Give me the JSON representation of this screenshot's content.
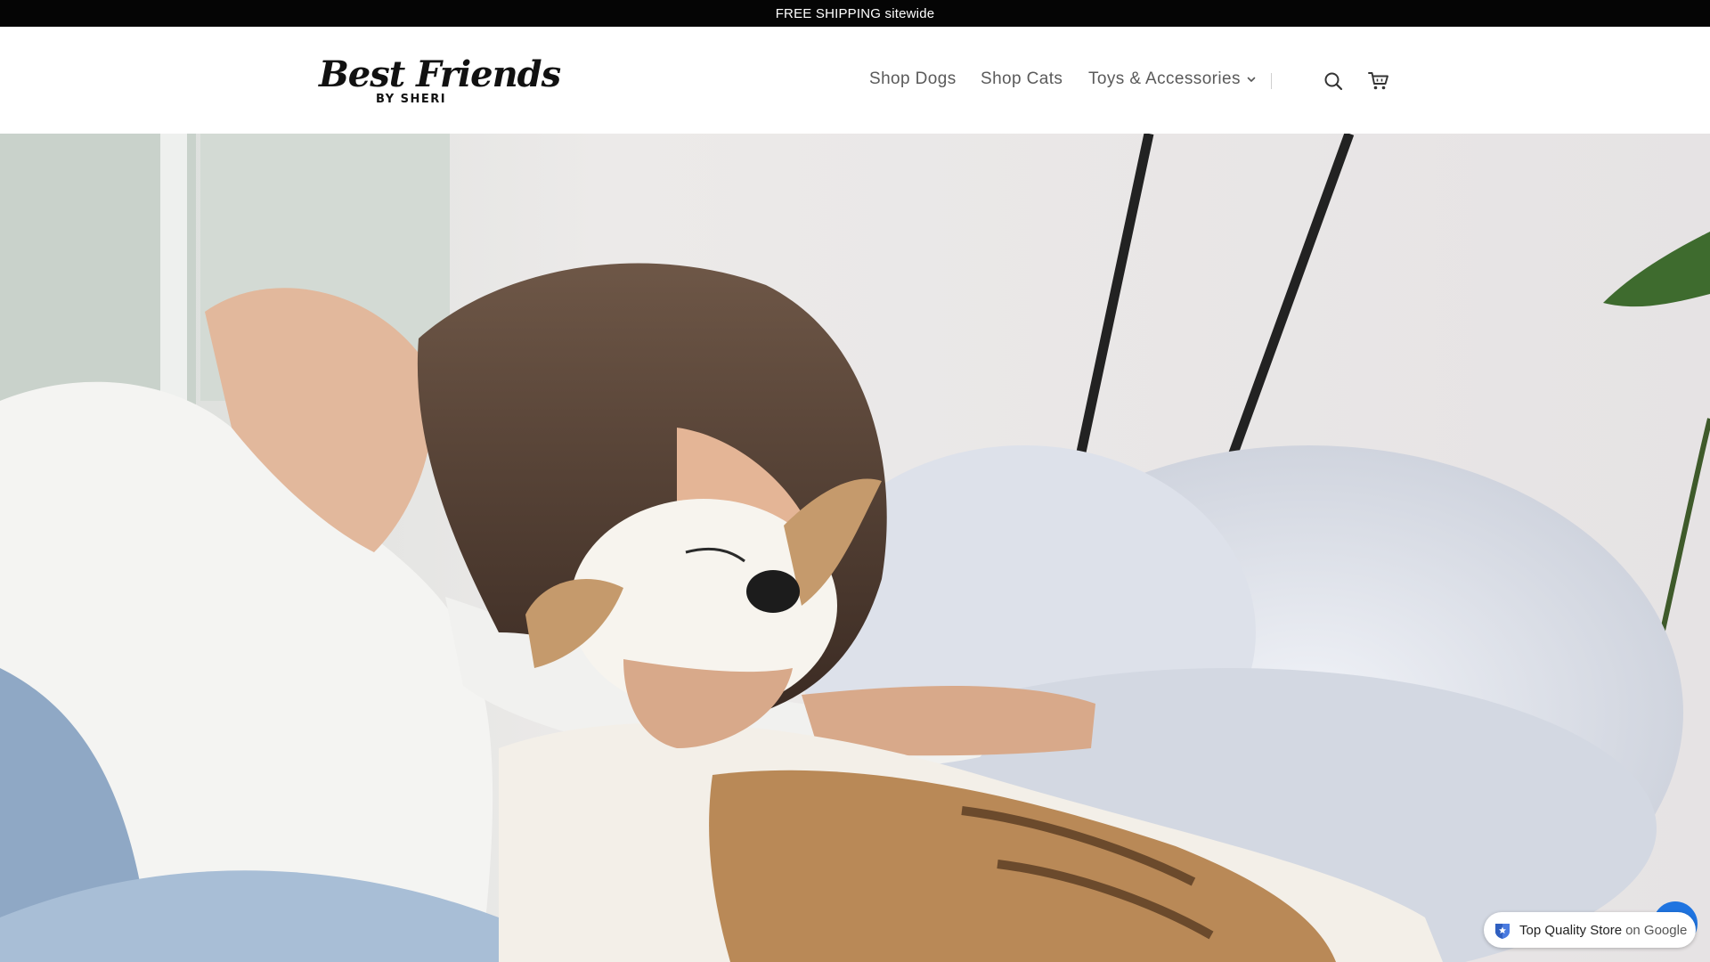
{
  "announcement": {
    "text": "FREE SHIPPING sitewide"
  },
  "brand": {
    "name": "Best Friends",
    "sub": "BY SHERI"
  },
  "nav": {
    "items": [
      {
        "label": "Shop Dogs"
      },
      {
        "label": "Shop Cats"
      },
      {
        "label": "Toys & Accessories",
        "has_dropdown": true
      }
    ]
  },
  "header_icons": [
    "search-icon",
    "cart-icon"
  ],
  "hero": {
    "image": "woman kissing dog on fluffy bed"
  },
  "badge": {
    "label": "Top Quality Store",
    "suffix": "on Google",
    "icon": "google-shield-icon"
  },
  "colors": {
    "announcement_bg": "#050505",
    "nav_text": "#5a5a5a",
    "chat_bubble": "#1f74e0"
  }
}
